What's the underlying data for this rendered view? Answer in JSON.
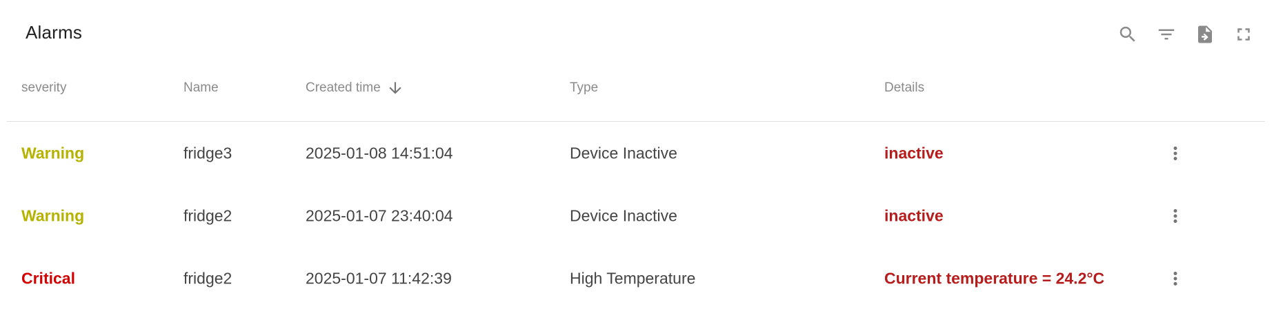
{
  "widget": {
    "title": "Alarms"
  },
  "toolbar": {
    "buttons": [
      {
        "icon": "search-icon"
      },
      {
        "icon": "filter-icon"
      },
      {
        "icon": "export-file-icon"
      },
      {
        "icon": "fullscreen-icon"
      }
    ]
  },
  "columns": {
    "severity": "severity",
    "name": "Name",
    "created_time": "Created time",
    "type": "Type",
    "details": "Details"
  },
  "sort": {
    "column": "created_time",
    "direction": "descending",
    "icon": "arrow-down-icon"
  },
  "colors": {
    "warning": "#b5b300",
    "critical": "#d50000",
    "details": "#b71c1c",
    "header_text": "#8a8a8a",
    "cell_text": "#444444"
  },
  "rows": [
    {
      "severity": "Warning",
      "severity_level": "warning",
      "name": "fridge3",
      "created_time": "2025-01-08 14:51:04",
      "type": "Device Inactive",
      "details": "inactive"
    },
    {
      "severity": "Warning",
      "severity_level": "warning",
      "name": "fridge2",
      "created_time": "2025-01-07 23:40:04",
      "type": "Device Inactive",
      "details": "inactive"
    },
    {
      "severity": "Critical",
      "severity_level": "critical",
      "name": "fridge2",
      "created_time": "2025-01-07 11:42:39",
      "type": "High Temperature",
      "details": "Current temperature = 24.2°C"
    }
  ]
}
